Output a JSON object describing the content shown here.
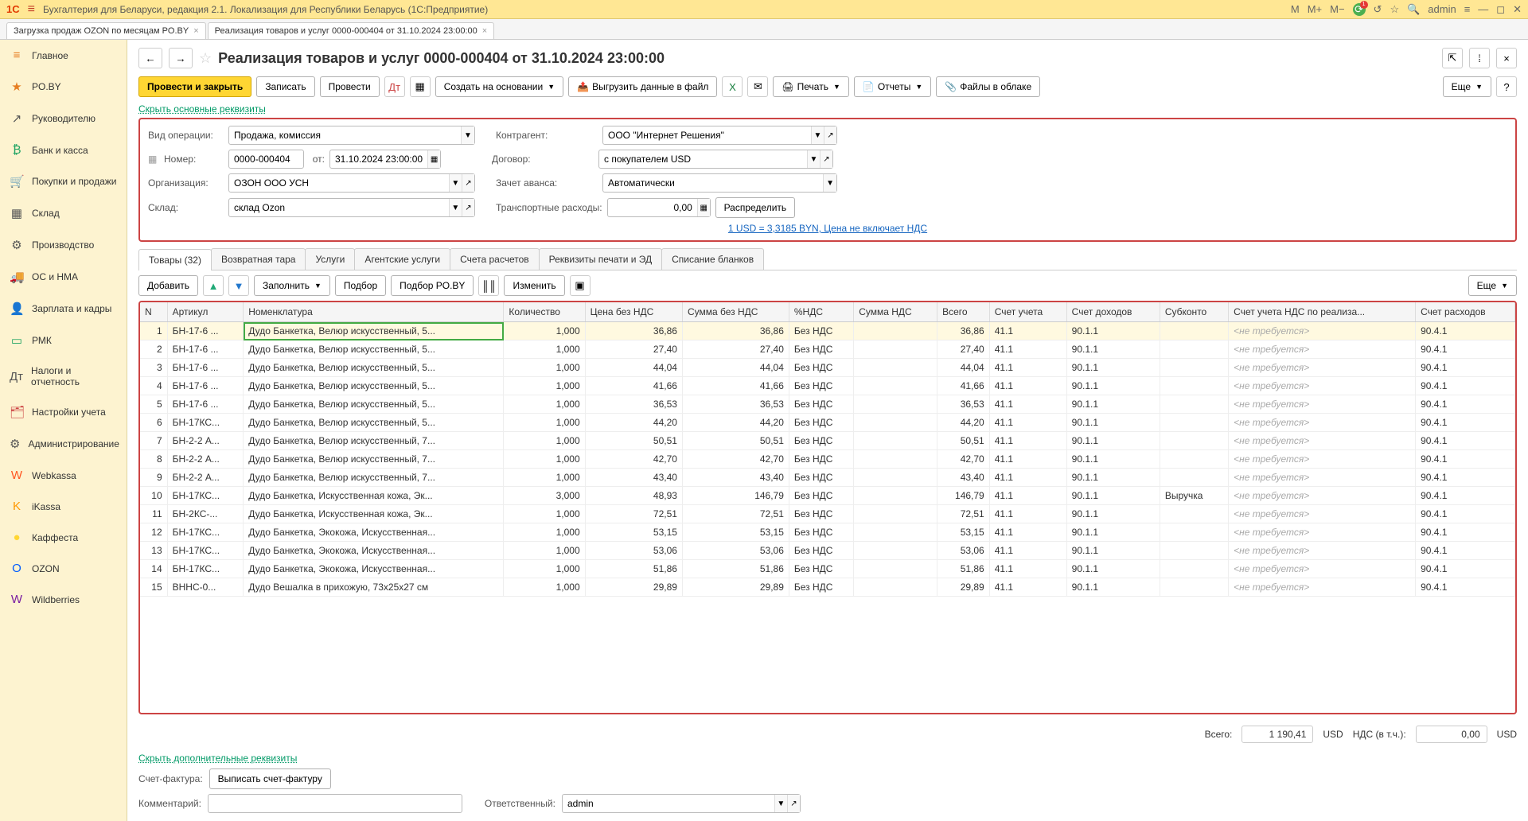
{
  "app": {
    "title": "Бухгалтерия для Беларуси, редакция 2.1. Локализация для Республики Беларусь   (1С:Предприятие)",
    "user": "admin",
    "logo": "1C",
    "m_plus": "M+",
    "m_minus": "M−",
    "m": "M",
    "notif_count": "1"
  },
  "tabs": [
    {
      "label": "Загрузка продаж OZON по месяцам PO.BY"
    },
    {
      "label": "Реализация товаров и услуг 0000-000404 от 31.10.2024 23:00:00"
    }
  ],
  "sidebar": [
    {
      "icon": "≡",
      "label": "Главное",
      "color": "#e67e22"
    },
    {
      "icon": "★",
      "label": "PO.BY",
      "color": "#e67e22"
    },
    {
      "icon": "↗",
      "label": "Руководителю",
      "color": "#555"
    },
    {
      "icon": "₿",
      "label": "Банк и касса",
      "color": "#1ea362"
    },
    {
      "icon": "🛒",
      "label": "Покупки и продажи",
      "color": "#e67e22"
    },
    {
      "icon": "▦",
      "label": "Склад",
      "color": "#555"
    },
    {
      "icon": "⚙",
      "label": "Производство",
      "color": "#555"
    },
    {
      "icon": "🚚",
      "label": "ОС и НМА",
      "color": "#7b5"
    },
    {
      "icon": "👤",
      "label": "Зарплата и кадры",
      "color": "#c44"
    },
    {
      "icon": "▭",
      "label": "РМК",
      "color": "#1ea362"
    },
    {
      "icon": "Дт",
      "label": "Налоги и отчетность",
      "color": "#555"
    },
    {
      "icon": "🗂",
      "label": "Настройки учета",
      "color": "#c44"
    },
    {
      "icon": "⚙",
      "label": "Администрирование",
      "color": "#555"
    },
    {
      "icon": "W",
      "label": "Webkassa",
      "color": "#ff5722"
    },
    {
      "icon": "K",
      "label": "iKassa",
      "color": "#ff9800"
    },
    {
      "icon": "●",
      "label": "Каффеста",
      "color": "#ffd633"
    },
    {
      "icon": "O",
      "label": "OZON",
      "color": "#005bff"
    },
    {
      "icon": "W",
      "label": "Wildberries",
      "color": "#7b1fa2"
    }
  ],
  "doc": {
    "title": "Реализация товаров и услуг 0000-000404 от 31.10.2024 23:00:00",
    "toolbar": {
      "post_close": "Провести и закрыть",
      "write": "Записать",
      "post": "Провести",
      "create_basis": "Создать на основании",
      "export_data": "Выгрузить данные в файл",
      "print": "Печать",
      "reports": "Отчеты",
      "files": "Файлы в облаке",
      "more": "Еще"
    },
    "hide_req": "Скрыть основные реквизиты",
    "fields": {
      "op_type_lbl": "Вид операции:",
      "op_type": "Продажа, комиссия",
      "number_lbl": "Номер:",
      "number": "0000-000404",
      "from_lbl": "от:",
      "date": "31.10.2024 23:00:00",
      "org_lbl": "Организация:",
      "org": "ОЗОН ООО УСН",
      "wh_lbl": "Склад:",
      "wh": "склад Ozon",
      "counterparty_lbl": "Контрагент:",
      "counterparty": "ООО \"Интернет Решения\"",
      "contract_lbl": "Договор:",
      "contract": "с покупателем USD",
      "prepay_lbl": "Зачет аванса:",
      "prepay": "Автоматически",
      "transport_lbl": "Транспортные расходы:",
      "transport": "0,00",
      "distribute": "Распределить",
      "rate_note": "1 USD = 3,3185 BYN, Цена не включает НДС"
    },
    "subtabs": [
      "Товары (32)",
      "Возвратная тара",
      "Услуги",
      "Агентские услуги",
      "Счета расчетов",
      "Реквизиты печати и ЭД",
      "Списание бланков"
    ],
    "tbl_toolbar": {
      "add": "Добавить",
      "fill": "Заполнить",
      "select": "Подбор",
      "select_poby": "Подбор PO.BY",
      "change": "Изменить",
      "more": "Еще"
    },
    "columns": [
      "N",
      "Артикул",
      "Номенклатура",
      "Количество",
      "Цена без НДС",
      "Сумма без НДС",
      "%НДС",
      "Сумма НДС",
      "Всего",
      "Счет учета",
      "Счет доходов",
      "Субконто",
      "Счет учета НДС по реализа...",
      "Счет расходов"
    ],
    "not_required": "<не требуется>",
    "rows": [
      {
        "n": 1,
        "art": "БН-17-6 ...",
        "nom": "Дудо Банкетка, Велюр искусственный, 5...",
        "qty": "1,000",
        "price": "36,86",
        "sum": "36,86",
        "vatp": "Без НДС",
        "vat": "",
        "total": "36,86",
        "acc": "41.1",
        "inc": "90.1.1",
        "sub": "",
        "exp": "90.4.1"
      },
      {
        "n": 2,
        "art": "БН-17-6 ...",
        "nom": "Дудо Банкетка, Велюр искусственный, 5...",
        "qty": "1,000",
        "price": "27,40",
        "sum": "27,40",
        "vatp": "Без НДС",
        "vat": "",
        "total": "27,40",
        "acc": "41.1",
        "inc": "90.1.1",
        "sub": "",
        "exp": "90.4.1"
      },
      {
        "n": 3,
        "art": "БН-17-6 ...",
        "nom": "Дудо Банкетка, Велюр искусственный, 5...",
        "qty": "1,000",
        "price": "44,04",
        "sum": "44,04",
        "vatp": "Без НДС",
        "vat": "",
        "total": "44,04",
        "acc": "41.1",
        "inc": "90.1.1",
        "sub": "",
        "exp": "90.4.1"
      },
      {
        "n": 4,
        "art": "БН-17-6 ...",
        "nom": "Дудо Банкетка, Велюр искусственный, 5...",
        "qty": "1,000",
        "price": "41,66",
        "sum": "41,66",
        "vatp": "Без НДС",
        "vat": "",
        "total": "41,66",
        "acc": "41.1",
        "inc": "90.1.1",
        "sub": "",
        "exp": "90.4.1"
      },
      {
        "n": 5,
        "art": "БН-17-6 ...",
        "nom": "Дудо Банкетка, Велюр искусственный, 5...",
        "qty": "1,000",
        "price": "36,53",
        "sum": "36,53",
        "vatp": "Без НДС",
        "vat": "",
        "total": "36,53",
        "acc": "41.1",
        "inc": "90.1.1",
        "sub": "",
        "exp": "90.4.1"
      },
      {
        "n": 6,
        "art": "БН-17КС...",
        "nom": "Дудо Банкетка, Велюр искусственный, 5...",
        "qty": "1,000",
        "price": "44,20",
        "sum": "44,20",
        "vatp": "Без НДС",
        "vat": "",
        "total": "44,20",
        "acc": "41.1",
        "inc": "90.1.1",
        "sub": "",
        "exp": "90.4.1"
      },
      {
        "n": 7,
        "art": "БН-2-2 А...",
        "nom": "Дудо Банкетка, Велюр искусственный, 7...",
        "qty": "1,000",
        "price": "50,51",
        "sum": "50,51",
        "vatp": "Без НДС",
        "vat": "",
        "total": "50,51",
        "acc": "41.1",
        "inc": "90.1.1",
        "sub": "",
        "exp": "90.4.1"
      },
      {
        "n": 8,
        "art": "БН-2-2 А...",
        "nom": "Дудо Банкетка, Велюр искусственный, 7...",
        "qty": "1,000",
        "price": "42,70",
        "sum": "42,70",
        "vatp": "Без НДС",
        "vat": "",
        "total": "42,70",
        "acc": "41.1",
        "inc": "90.1.1",
        "sub": "",
        "exp": "90.4.1"
      },
      {
        "n": 9,
        "art": "БН-2-2 А...",
        "nom": "Дудо Банкетка, Велюр искусственный, 7...",
        "qty": "1,000",
        "price": "43,40",
        "sum": "43,40",
        "vatp": "Без НДС",
        "vat": "",
        "total": "43,40",
        "acc": "41.1",
        "inc": "90.1.1",
        "sub": "",
        "exp": "90.4.1"
      },
      {
        "n": 10,
        "art": "БН-17КС...",
        "nom": "Дудо Банкетка, Искусственная кожа, Эк...",
        "qty": "3,000",
        "price": "48,93",
        "sum": "146,79",
        "vatp": "Без НДС",
        "vat": "",
        "total": "146,79",
        "acc": "41.1",
        "inc": "90.1.1",
        "sub": "Выручка",
        "exp": "90.4.1"
      },
      {
        "n": 11,
        "art": "БН-2КС-...",
        "nom": "Дудо Банкетка, Искусственная кожа, Эк...",
        "qty": "1,000",
        "price": "72,51",
        "sum": "72,51",
        "vatp": "Без НДС",
        "vat": "",
        "total": "72,51",
        "acc": "41.1",
        "inc": "90.1.1",
        "sub": "",
        "exp": "90.4.1"
      },
      {
        "n": 12,
        "art": "БН-17КС...",
        "nom": "Дудо Банкетка, Экокожа, Искусственная...",
        "qty": "1,000",
        "price": "53,15",
        "sum": "53,15",
        "vatp": "Без НДС",
        "vat": "",
        "total": "53,15",
        "acc": "41.1",
        "inc": "90.1.1",
        "sub": "",
        "exp": "90.4.1"
      },
      {
        "n": 13,
        "art": "БН-17КС...",
        "nom": "Дудо Банкетка, Экокожа, Искусственная...",
        "qty": "1,000",
        "price": "53,06",
        "sum": "53,06",
        "vatp": "Без НДС",
        "vat": "",
        "total": "53,06",
        "acc": "41.1",
        "inc": "90.1.1",
        "sub": "",
        "exp": "90.4.1"
      },
      {
        "n": 14,
        "art": "БН-17КС...",
        "nom": "Дудо Банкетка, Экокожа, Искусственная...",
        "qty": "1,000",
        "price": "51,86",
        "sum": "51,86",
        "vatp": "Без НДС",
        "vat": "",
        "total": "51,86",
        "acc": "41.1",
        "inc": "90.1.1",
        "sub": "",
        "exp": "90.4.1"
      },
      {
        "n": 15,
        "art": "ВННС-0...",
        "nom": "Дудо Вешалка в прихожую, 73х25х27 см",
        "qty": "1,000",
        "price": "29,89",
        "sum": "29,89",
        "vatp": "Без НДС",
        "vat": "",
        "total": "29,89",
        "acc": "41.1",
        "inc": "90.1.1",
        "sub": "",
        "exp": "90.4.1"
      }
    ],
    "totals": {
      "all_lbl": "Всего:",
      "all": "1 190,41",
      "cur1": "USD",
      "vat_lbl": "НДС (в т.ч.):",
      "vat": "0,00",
      "cur2": "USD"
    },
    "extra_link": "Скрыть дополнительные реквизиты",
    "invoice_lbl": "Счет-фактура:",
    "invoice_btn": "Выписать счет-фактуру",
    "comment_lbl": "Комментарий:",
    "resp_lbl": "Ответственный:",
    "resp": "admin"
  }
}
